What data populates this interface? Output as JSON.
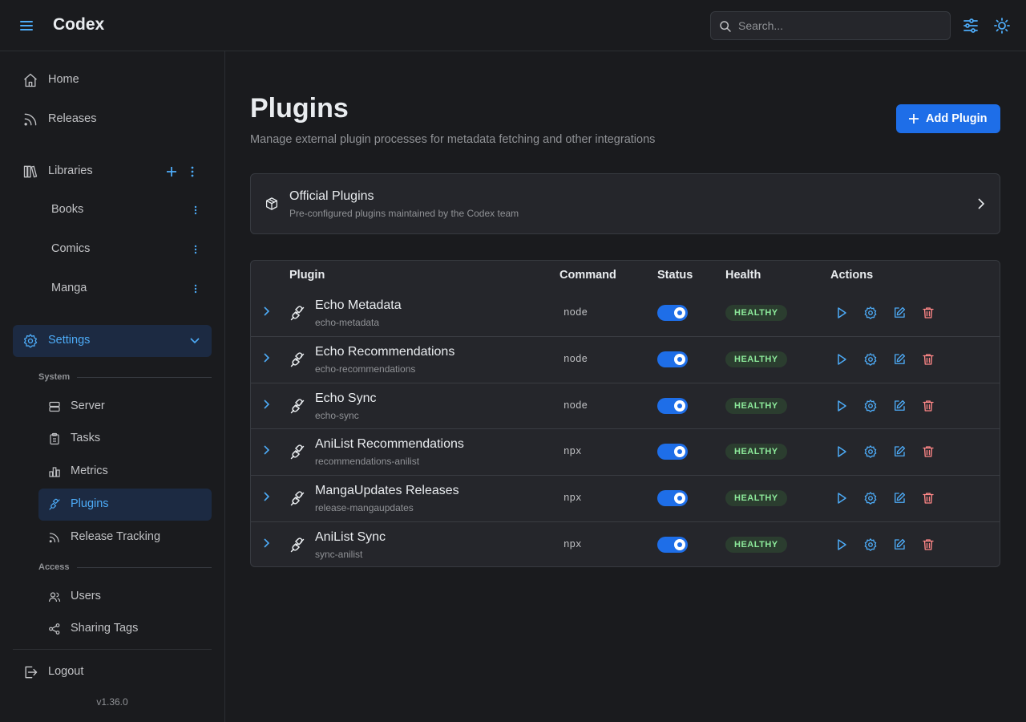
{
  "header": {
    "app_title": "Codex",
    "search_placeholder": "Search..."
  },
  "sidebar": {
    "nav": [
      {
        "label": "Home",
        "icon": "home-icon"
      },
      {
        "label": "Releases",
        "icon": "rss-icon"
      }
    ],
    "libraries": {
      "label": "Libraries",
      "items": [
        {
          "label": "Books"
        },
        {
          "label": "Comics"
        },
        {
          "label": "Manga"
        }
      ]
    },
    "settings": {
      "label": "Settings",
      "sections": [
        {
          "label": "System",
          "items": [
            {
              "label": "Server",
              "icon": "server-icon"
            },
            {
              "label": "Tasks",
              "icon": "clipboard-icon"
            },
            {
              "label": "Metrics",
              "icon": "bar-chart-icon"
            },
            {
              "label": "Plugins",
              "icon": "plug-icon",
              "active": true
            },
            {
              "label": "Release Tracking",
              "icon": "rss-icon"
            }
          ]
        },
        {
          "label": "Access",
          "items": [
            {
              "label": "Users",
              "icon": "users-icon"
            },
            {
              "label": "Sharing Tags",
              "icon": "share-icon"
            }
          ]
        }
      ]
    },
    "logout_label": "Logout",
    "version": "v1.36.0"
  },
  "main": {
    "title": "Plugins",
    "subtitle": "Manage external plugin processes for metadata fetching and other integrations",
    "add_button_label": "Add Plugin",
    "official": {
      "title": "Official Plugins",
      "subtitle": "Pre-configured plugins maintained by the Codex team"
    },
    "table": {
      "columns": [
        "Plugin",
        "Command",
        "Status",
        "Health",
        "Actions"
      ],
      "rows": [
        {
          "name": "Echo Metadata",
          "id": "echo-metadata",
          "command": "node",
          "enabled": true,
          "health": "HEALTHY"
        },
        {
          "name": "Echo Recommendations",
          "id": "echo-recommendations",
          "command": "node",
          "enabled": true,
          "health": "HEALTHY"
        },
        {
          "name": "Echo Sync",
          "id": "echo-sync",
          "command": "node",
          "enabled": true,
          "health": "HEALTHY"
        },
        {
          "name": "AniList Recommendations",
          "id": "recommendations-anilist",
          "command": "npx",
          "enabled": true,
          "health": "HEALTHY"
        },
        {
          "name": "MangaUpdates Releases",
          "id": "release-mangaupdates",
          "command": "npx",
          "enabled": true,
          "health": "HEALTHY"
        },
        {
          "name": "AniList Sync",
          "id": "sync-anilist",
          "command": "npx",
          "enabled": true,
          "health": "HEALTHY"
        }
      ]
    }
  },
  "colors": {
    "accent": "#4dabf7",
    "primary_button": "#1e6ee8",
    "healthy_text": "#8ce99a",
    "delete": "#ff8787"
  }
}
